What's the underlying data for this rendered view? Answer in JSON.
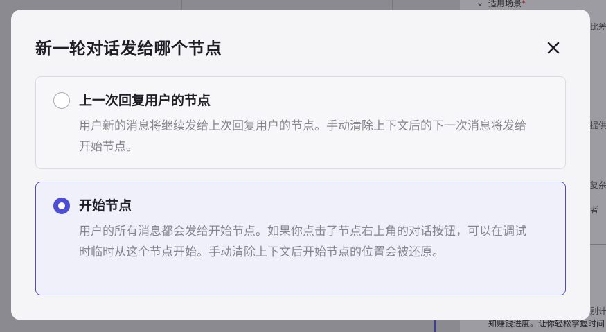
{
  "background": {
    "section_label": "适用场景",
    "required_mark": "*",
    "snippet_1": "比差异",
    "snippet_2": "提供",
    "snippet_3": "复杂",
    "snippet_4": "者",
    "snippet_5": "别计",
    "snippet_6": "知赚钱进度。让你轻松掌握时间"
  },
  "modal": {
    "title": "新一轮对话发给哪个节点",
    "close_icon": "close-icon",
    "options": [
      {
        "title": "上一次回复用户的节点",
        "description": "用户新的消息将继续发给上次回复用户的节点。手动清除上下文后的下一次消息将发给开始节点。",
        "selected": false
      },
      {
        "title": "开始节点",
        "description": "用户的所有消息都会发给开始节点。如果你点击了节点右上角的对话按钮，可以在调试时临时从这个节点开始。手动清除上下文后开始节点的位置会被还原。",
        "selected": true
      }
    ]
  },
  "colors": {
    "accent": "#4e4ed4",
    "selected_border": "#4c4cb8",
    "selected_bg": "#f0f0fb",
    "title_text": "#1e1e24",
    "desc_text": "#86868e"
  }
}
